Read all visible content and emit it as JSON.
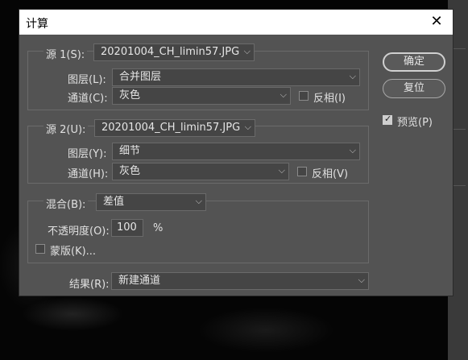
{
  "dialog": {
    "title": "计算",
    "close_glyph": "✕",
    "source1": {
      "label": "源 1(S):",
      "file": "20201004_CH_limin57.JPG",
      "layer_label": "图层(L):",
      "layer_value": "合并图层",
      "channel_label": "通道(C):",
      "channel_value": "灰色",
      "invert_label": "反相(I)",
      "invert_checked": false
    },
    "source2": {
      "label": "源 2(U):",
      "file": "20201004_CH_limin57.JPG",
      "layer_label": "图层(Y):",
      "layer_value": "细节",
      "channel_label": "通道(H):",
      "channel_value": "灰色",
      "invert_label": "反相(V)",
      "invert_checked": false
    },
    "blending": {
      "label": "混合(B):",
      "value": "差值",
      "opacity_label": "不透明度(O):",
      "opacity_value": "100",
      "opacity_unit": "%",
      "mask_label": "蒙版(K)...",
      "mask_checked": false
    },
    "result": {
      "label": "结果(R):",
      "value": "新建通道"
    },
    "buttons": {
      "ok": "确定",
      "reset": "复位"
    },
    "preview": {
      "label": "预览(P)",
      "checked": true
    }
  },
  "icons": {
    "dropdown_arrow": "chevron-down-icon",
    "close": "close-icon"
  }
}
